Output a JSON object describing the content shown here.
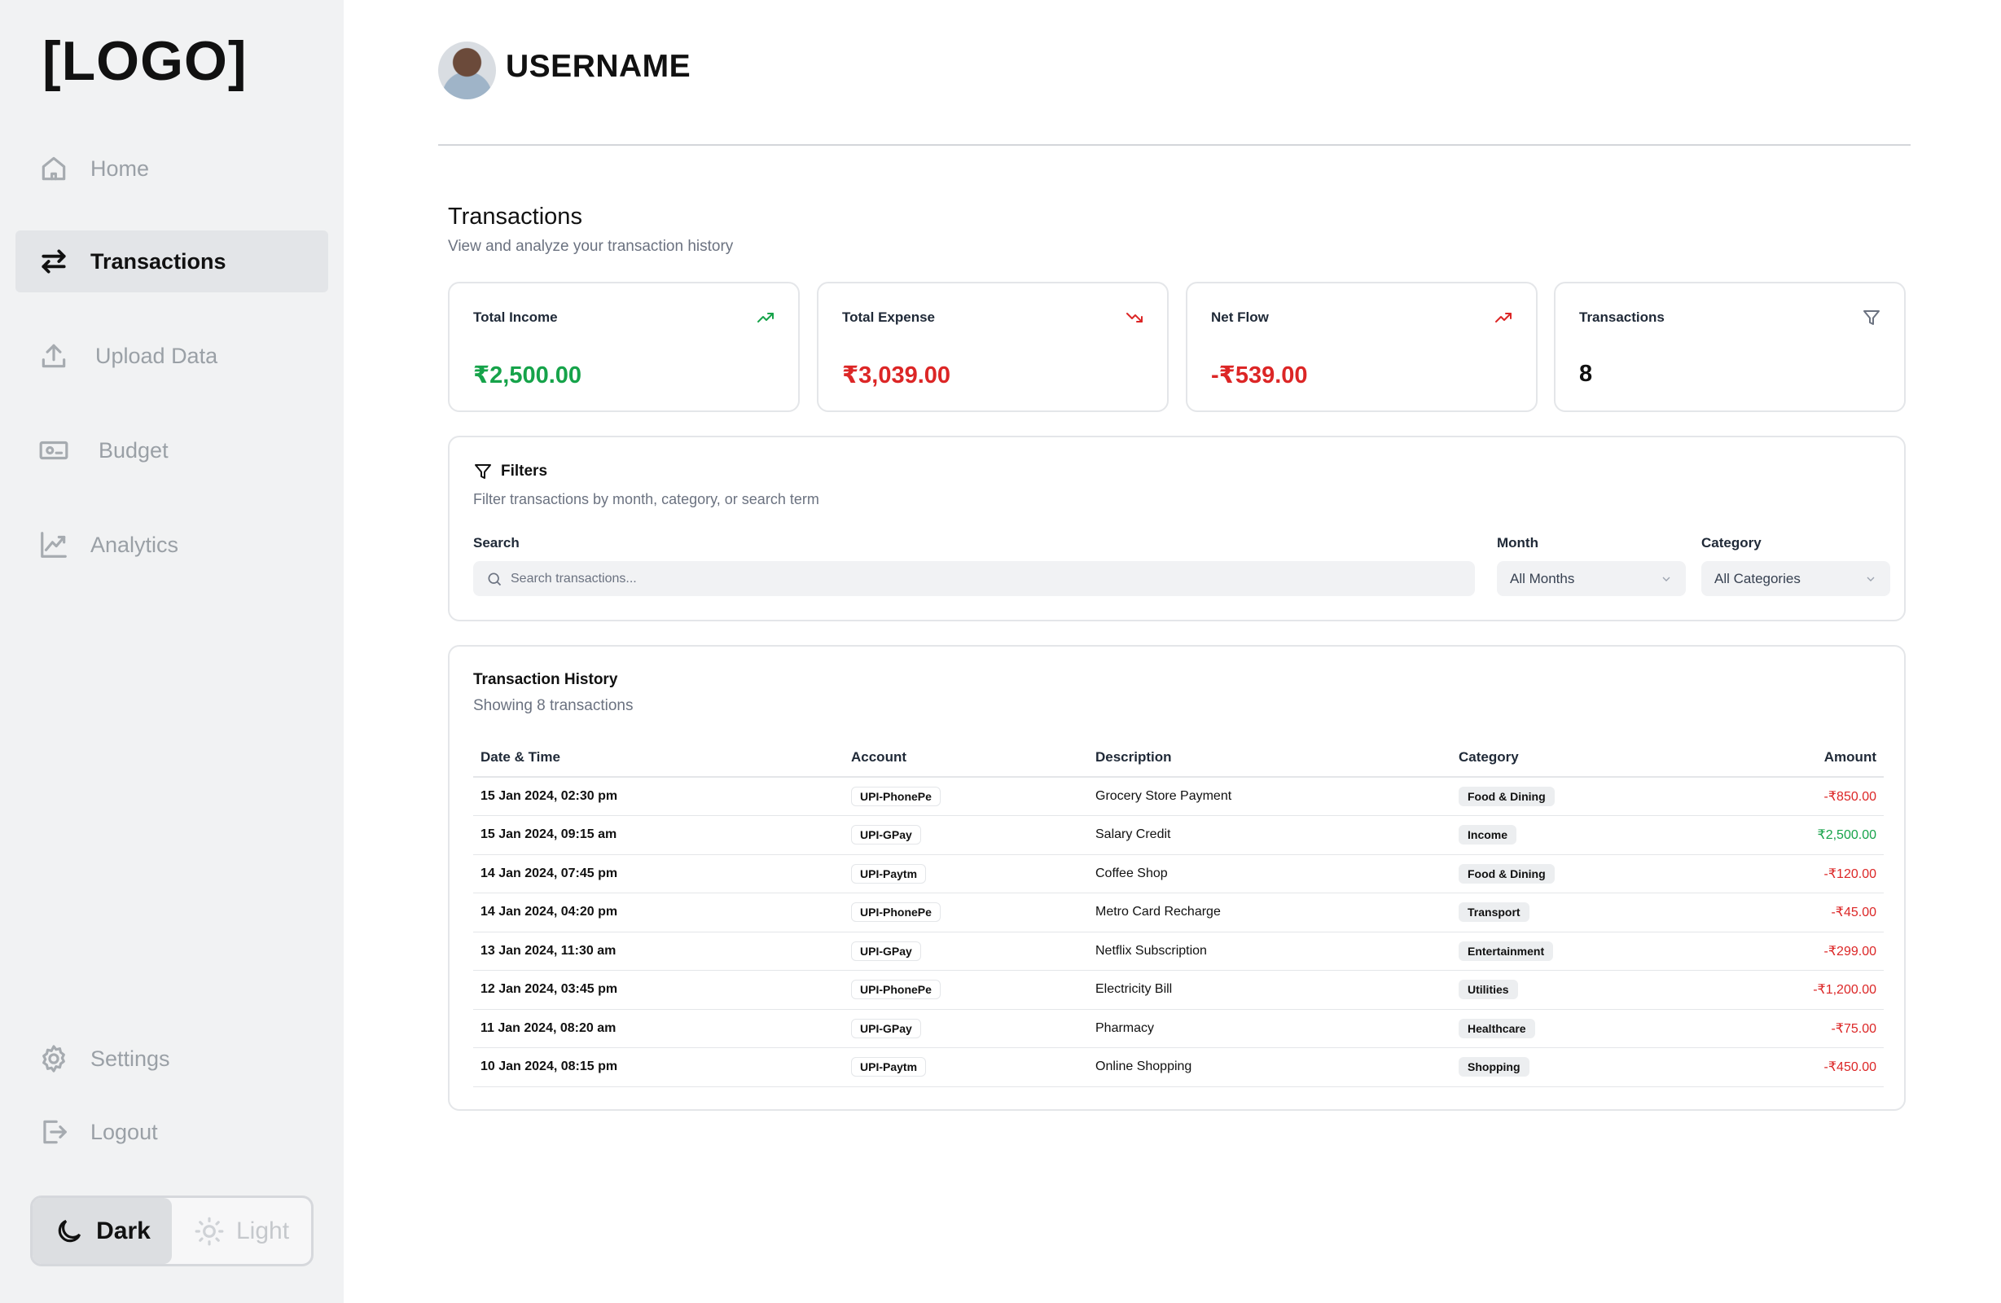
{
  "sidebar": {
    "logo": "[LOGO]",
    "items": [
      {
        "label": "Home",
        "icon": "home-icon"
      },
      {
        "label": "Transactions",
        "icon": "arrows-swap-icon",
        "active": true
      },
      {
        "label": "Upload Data",
        "icon": "upload-icon"
      },
      {
        "label": "Budget",
        "icon": "banknote-icon"
      },
      {
        "label": "Analytics",
        "icon": "chart-line-icon"
      }
    ],
    "bottom_items": [
      {
        "label": "Settings",
        "icon": "gear-icon"
      },
      {
        "label": "Logout",
        "icon": "logout-icon"
      }
    ],
    "theme": {
      "dark_label": "Dark",
      "light_label": "Light",
      "selected": "Dark"
    }
  },
  "header": {
    "username": "USERNAME"
  },
  "page": {
    "title": "Transactions",
    "subtitle": "View and analyze your transaction history"
  },
  "stats": [
    {
      "label": "Total Income",
      "value": "₹2,500.00",
      "icon": "trending-up-icon",
      "color": "#16a34a"
    },
    {
      "label": "Total Expense",
      "value": "₹3,039.00",
      "icon": "trending-down-icon",
      "color": "#dc2626"
    },
    {
      "label": "Net Flow",
      "value": "-₹539.00",
      "icon": "trending-up-icon",
      "color": "#dc2626"
    },
    {
      "label": "Transactions",
      "value": "8",
      "icon": "filter-icon",
      "color": "#111111"
    }
  ],
  "filters": {
    "title": "Filters",
    "subtitle": "Filter transactions by month, category, or search term",
    "search_label": "Search",
    "search_placeholder": "Search transactions...",
    "month_label": "Month",
    "month_value": "All Months",
    "category_label": "Category",
    "category_value": "All Categories"
  },
  "history": {
    "title": "Transaction History",
    "subtitle": "Showing 8 transactions",
    "columns": [
      "Date & Time",
      "Account",
      "Description",
      "Category",
      "Amount"
    ],
    "rows": [
      {
        "date": "15 Jan 2024, 02:30 pm",
        "account": "UPI-PhonePe",
        "description": "Grocery Store Payment",
        "category": "Food & Dining",
        "amount": "-₹850.00",
        "type": "expense"
      },
      {
        "date": "15 Jan 2024, 09:15 am",
        "account": "UPI-GPay",
        "description": "Salary Credit",
        "category": "Income",
        "amount": "₹2,500.00",
        "type": "income"
      },
      {
        "date": "14 Jan 2024, 07:45 pm",
        "account": "UPI-Paytm",
        "description": "Coffee Shop",
        "category": "Food & Dining",
        "amount": "-₹120.00",
        "type": "expense"
      },
      {
        "date": "14 Jan 2024, 04:20 pm",
        "account": "UPI-PhonePe",
        "description": "Metro Card Recharge",
        "category": "Transport",
        "amount": "-₹45.00",
        "type": "expense"
      },
      {
        "date": "13 Jan 2024, 11:30 am",
        "account": "UPI-GPay",
        "description": "Netflix Subscription",
        "category": "Entertainment",
        "amount": "-₹299.00",
        "type": "expense"
      },
      {
        "date": "12 Jan 2024, 03:45 pm",
        "account": "UPI-PhonePe",
        "description": "Electricity Bill",
        "category": "Utilities",
        "amount": "-₹1,200.00",
        "type": "expense"
      },
      {
        "date": "11 Jan 2024, 08:20 am",
        "account": "UPI-GPay",
        "description": "Pharmacy",
        "category": "Healthcare",
        "amount": "-₹75.00",
        "type": "expense"
      },
      {
        "date": "10 Jan 2024, 08:15 pm",
        "account": "UPI-Paytm",
        "description": "Online Shopping",
        "category": "Shopping",
        "amount": "-₹450.00",
        "type": "expense"
      }
    ]
  }
}
